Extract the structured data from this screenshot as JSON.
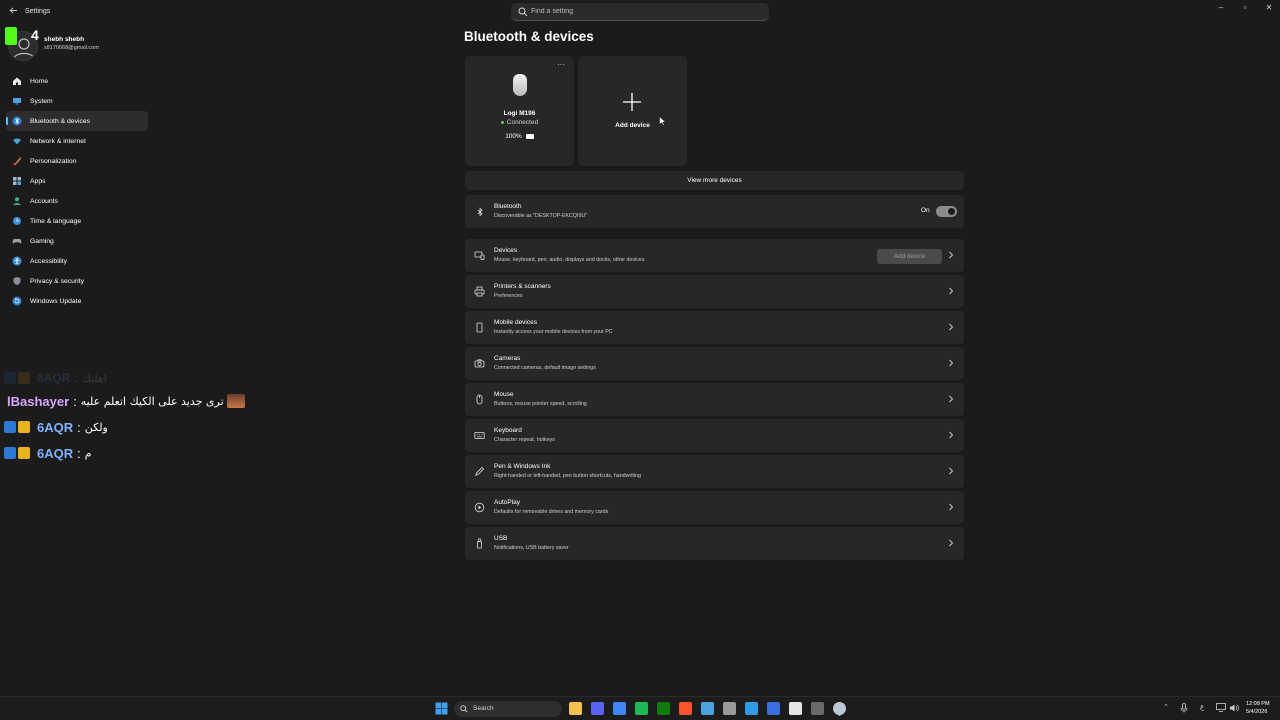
{
  "window": {
    "title": "Settings",
    "search_placeholder": "Find a setting",
    "controls": {
      "minimize": "–",
      "maximize": "▫",
      "close": "✕"
    }
  },
  "overlay": {
    "logo_number": "4"
  },
  "profile": {
    "name": "shebh shebh",
    "email": "s8170668@gmail.com"
  },
  "sidebar": {
    "items": [
      {
        "label": "Home",
        "icon": "home-icon"
      },
      {
        "label": "System",
        "icon": "monitor-icon"
      },
      {
        "label": "Bluetooth & devices",
        "icon": "bluetooth-icon",
        "active": true
      },
      {
        "label": "Network & internet",
        "icon": "wifi-icon"
      },
      {
        "label": "Personalization",
        "icon": "brush-icon"
      },
      {
        "label": "Apps",
        "icon": "apps-icon"
      },
      {
        "label": "Accounts",
        "icon": "person-icon"
      },
      {
        "label": "Time & language",
        "icon": "globe-clock-icon"
      },
      {
        "label": "Gaming",
        "icon": "gamepad-icon"
      },
      {
        "label": "Accessibility",
        "icon": "accessibility-icon"
      },
      {
        "label": "Privacy & security",
        "icon": "shield-icon"
      },
      {
        "label": "Windows Update",
        "icon": "update-icon"
      }
    ]
  },
  "chat": {
    "messages": [
      {
        "user": "6AQR",
        "text": "اهلنك",
        "faded": true
      },
      {
        "user": "lBashayer",
        "text": "ترى جديد على الكيك اتعلم عليه",
        "user_color": "#d9a6ff"
      },
      {
        "user": "6AQR",
        "text": "ولكن",
        "user_color": "#7fb2ff"
      },
      {
        "user": "6AQR",
        "text": "م",
        "user_color": "#7fb2ff"
      }
    ]
  },
  "main": {
    "title": "Bluetooth & devices",
    "device_card": {
      "name": "Logi M196",
      "status": "Connected",
      "battery": "100%",
      "more": "···"
    },
    "add_card_label": "Add device",
    "view_more": "View more devices",
    "bluetooth": {
      "title": "Bluetooth",
      "subtitle": "Discoverable as \"DESKTOP-EKCQI9U\"",
      "toggle_label": "On",
      "enabled": true
    },
    "rows": [
      {
        "title": "Devices",
        "subtitle": "Mouse, keyboard, pen, audio, displays and docks, other devices",
        "icon": "devices-icon",
        "button": "Add device"
      },
      {
        "title": "Printers & scanners",
        "subtitle": "Preferences",
        "icon": "printer-icon"
      },
      {
        "title": "Mobile devices",
        "subtitle": "Instantly access your mobile devices from your PC",
        "icon": "phone-icon"
      },
      {
        "title": "Cameras",
        "subtitle": "Connected cameras, default image settings",
        "icon": "camera-icon"
      },
      {
        "title": "Mouse",
        "subtitle": "Buttons, mouse pointer speed, scrolling",
        "icon": "mouse-icon"
      },
      {
        "title": "Keyboard",
        "subtitle": "Character repeat, hotkeys",
        "icon": "keyboard-icon"
      },
      {
        "title": "Pen & Windows Ink",
        "subtitle": "Right-handed or left-handed, pen button shortcuts, handwriting",
        "icon": "pen-icon"
      },
      {
        "title": "AutoPlay",
        "subtitle": "Defaults for removable drives and memory cards",
        "icon": "autoplay-icon"
      },
      {
        "title": "USB",
        "subtitle": "Notifications, USB battery saver",
        "icon": "usb-icon"
      }
    ]
  },
  "taskbar": {
    "search_label": "Search",
    "apps": [
      {
        "name": "file-explorer-icon",
        "color": "#f2c14e"
      },
      {
        "name": "discord-icon",
        "color": "#5865f2"
      },
      {
        "name": "chrome-icon",
        "color": "#4285f4"
      },
      {
        "name": "app-green-icon",
        "color": "#1db954"
      },
      {
        "name": "xbox-icon",
        "color": "#107c10"
      },
      {
        "name": "brave-icon",
        "color": "#fb542b"
      },
      {
        "name": "defender-icon",
        "color": "#4aa3df"
      },
      {
        "name": "app-grid-icon",
        "color": "#9a9a9a"
      },
      {
        "name": "edge-icon",
        "color": "#2e9be6"
      },
      {
        "name": "app-blue-icon",
        "color": "#3a6fe0"
      },
      {
        "name": "capcut-icon",
        "color": "#e6e6e6"
      },
      {
        "name": "calculator-icon",
        "color": "#6a6a6a"
      },
      {
        "name": "settings-icon",
        "color": "#bfc8d6"
      }
    ],
    "lang": "ع",
    "time": "12:08 PM",
    "date": "5/4/2026"
  },
  "colors": {
    "accent": "#4cc2ff",
    "background": "#1b1b1b",
    "card": "#272727",
    "kick_green": "#53fc18"
  }
}
